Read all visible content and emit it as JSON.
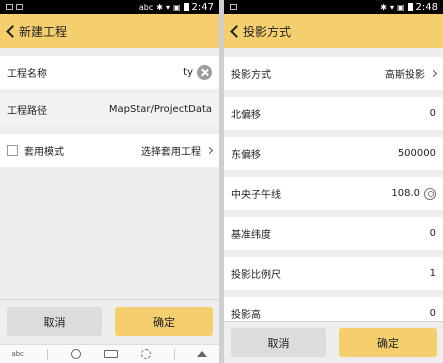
{
  "left": {
    "status": {
      "left_text": "",
      "right_text": "abc",
      "time": "2:47"
    },
    "title": "新建工程",
    "fields": {
      "name_label": "工程名称",
      "name_value": "ty",
      "path_label": "工程路径",
      "path_value": "MapStar/ProjectData",
      "template_label": "套用模式",
      "template_value": "选择套用工程"
    },
    "buttons": {
      "cancel": "取消",
      "ok": "确定"
    },
    "keyboard": {
      "abc": "abc"
    }
  },
  "right": {
    "status": {
      "time": "2:48"
    },
    "title": "投影方式",
    "rows": [
      {
        "label": "投影方式",
        "value": "高斯投影"
      },
      {
        "label": "北偏移",
        "value": "0"
      },
      {
        "label": "东偏移",
        "value": "500000"
      },
      {
        "label": "中央子午线",
        "value": "108.0"
      },
      {
        "label": "基准纬度",
        "value": "0"
      },
      {
        "label": "投影比例尺",
        "value": "1"
      },
      {
        "label": "投影高",
        "value": "0"
      }
    ],
    "buttons": {
      "cancel": "取消",
      "ok": "确定"
    }
  },
  "colors": {
    "accent": "#f5cf6e",
    "cancel_bg": "#dcdcdc"
  }
}
